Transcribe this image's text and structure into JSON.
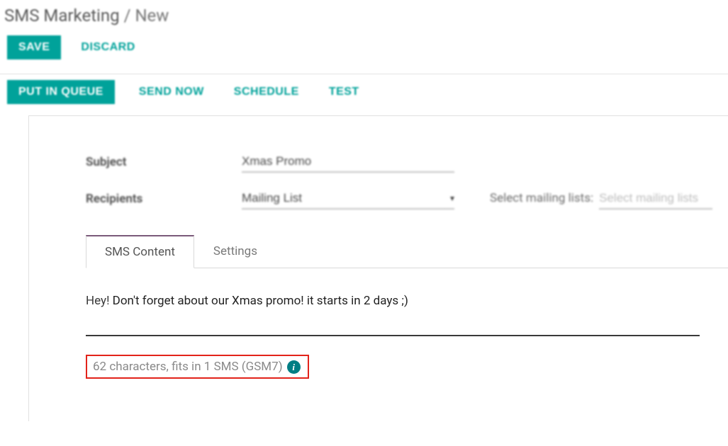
{
  "breadcrumb": {
    "module": "SMS Marketing",
    "separator": "/",
    "current": "New"
  },
  "header_buttons": {
    "save": "SAVE",
    "discard": "DISCARD"
  },
  "action_buttons": {
    "put_in_queue": "PUT IN QUEUE",
    "send_now": "SEND NOW",
    "schedule": "SCHEDULE",
    "test": "TEST"
  },
  "fields": {
    "subject": {
      "label": "Subject",
      "value": "Xmas Promo"
    },
    "recipients": {
      "label": "Recipients",
      "value": "Mailing List"
    },
    "mailing_lists": {
      "label": "Select mailing lists:",
      "placeholder": "Select mailing lists"
    }
  },
  "tabs": {
    "sms_content": "SMS Content",
    "settings": "Settings"
  },
  "sms": {
    "greeting": "Hey!",
    "body": " Don't forget about our Xmas promo! it starts in 2 days ;)"
  },
  "char_count": {
    "text": "62 characters, fits in 1 SMS (GSM7)"
  },
  "icons": {
    "info": "i"
  }
}
